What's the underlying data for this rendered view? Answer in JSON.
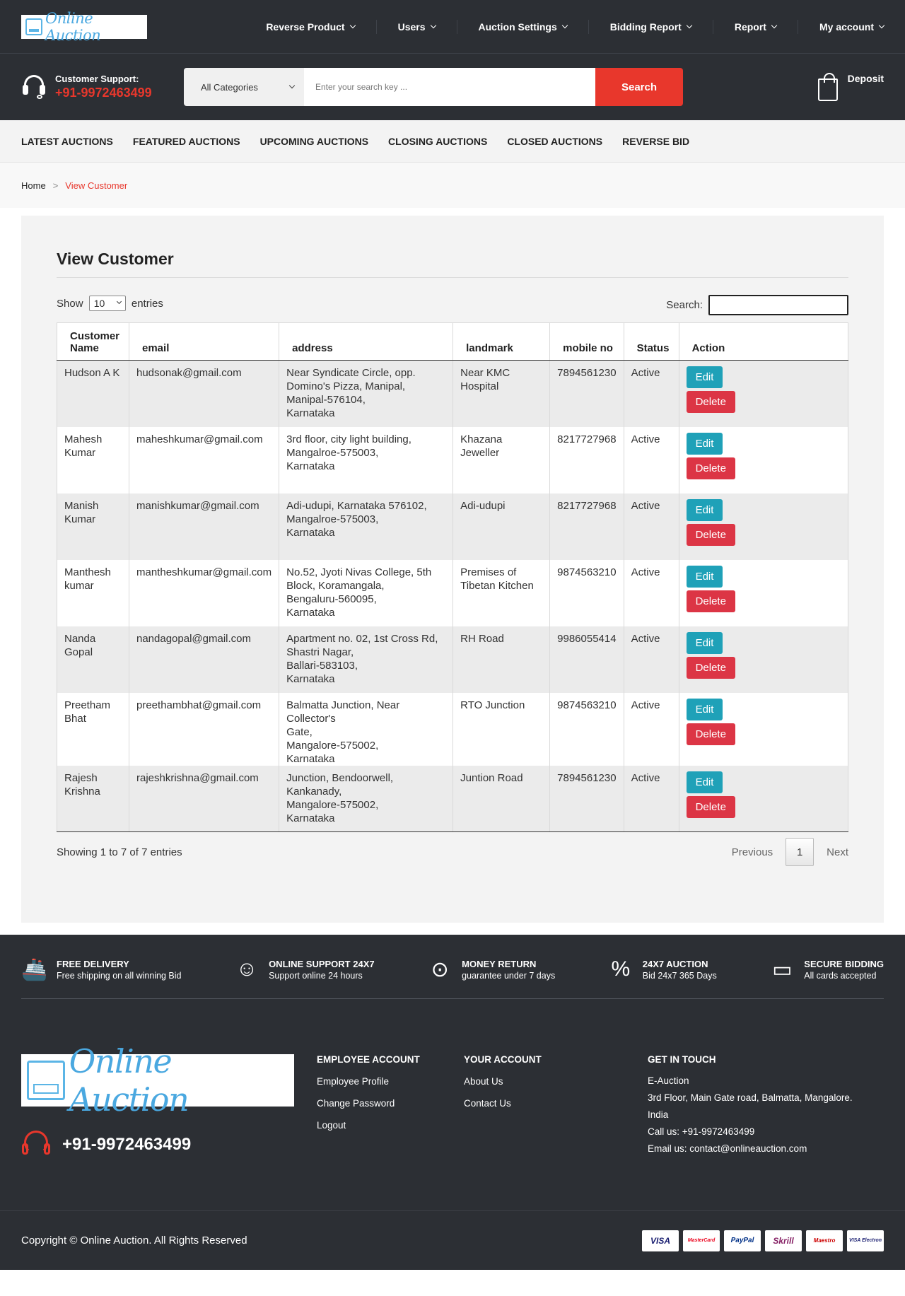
{
  "brand": {
    "logo_text": "Online Auction"
  },
  "topnav": [
    {
      "label": "Reverse Product"
    },
    {
      "label": "Users"
    },
    {
      "label": "Auction Settings"
    },
    {
      "label": "Bidding Report"
    },
    {
      "label": "Report"
    },
    {
      "label": "My account"
    }
  ],
  "support": {
    "label": "Customer Support:",
    "phone": "+91-9972463499"
  },
  "search": {
    "category": "All Categories",
    "placeholder": "Enter your search key ...",
    "button": "Search"
  },
  "deposit": {
    "label": "Deposit"
  },
  "catnav": [
    "LATEST AUCTIONS",
    "FEATURED AUCTIONS",
    "UPCOMING AUCTIONS",
    "CLOSING AUCTIONS",
    "CLOSED AUCTIONS",
    "REVERSE BID"
  ],
  "breadcrumb": {
    "home": "Home",
    "sep": ">",
    "current": "View Customer"
  },
  "page": {
    "title": "View Customer"
  },
  "table_controls": {
    "show": "Show",
    "entries_value": "10",
    "entries": "entries",
    "search_label": "Search:"
  },
  "table": {
    "headers": [
      "Customer Name",
      "email",
      "address",
      "landmark",
      "mobile no",
      "Status",
      "Action"
    ],
    "rows": [
      {
        "name": "Hudson A K",
        "email": "hudsonak@gmail.com",
        "address": "Near Syndicate Circle, opp.\nDomino's Pizza, Manipal,\nManipal-576104,\nKarnataka",
        "landmark": "Near KMC Hospital",
        "mobile": "7894561230",
        "status": "Active"
      },
      {
        "name": "Mahesh\nKumar",
        "email": "maheshkumar@gmail.com",
        "address": "3rd floor, city light building,\nMangalroe-575003,\nKarnataka",
        "landmark": "Khazana Jeweller",
        "mobile": "8217727968",
        "status": "Active"
      },
      {
        "name": "Manish\nKumar",
        "email": "manishkumar@gmail.com",
        "address": "Adi-udupi, Karnataka 576102,\nMangalroe-575003,\nKarnataka",
        "landmark": "Adi-udupi",
        "mobile": "8217727968",
        "status": "Active"
      },
      {
        "name": "Manthesh\nkumar",
        "email": "mantheshkumar@gmail.com",
        "address": "No.52, Jyoti Nivas College, 5th\nBlock, Koramangala,\nBengaluru-560095,\nKarnataka",
        "landmark": "Premises of\nTibetan Kitchen",
        "mobile": "9874563210",
        "status": "Active"
      },
      {
        "name": "Nanda\nGopal",
        "email": "nandagopal@gmail.com",
        "address": "Apartment no. 02, 1st Cross Rd,\nShastri Nagar,\nBallari-583103,\nKarnataka",
        "landmark": "RH Road",
        "mobile": "9986055414",
        "status": "Active"
      },
      {
        "name": "Preetham\nBhat",
        "email": "preethambhat@gmail.com",
        "address": "Balmatta Junction, Near Collector's\nGate,\nMangalore-575002,\nKarnataka",
        "landmark": "RTO Junction",
        "mobile": "9874563210",
        "status": "Active"
      },
      {
        "name": "Rajesh\nKrishna",
        "email": "rajeshkrishna@gmail.com",
        "address": "Junction, Bendoorwell, Kankanady,\nMangalore-575002,\nKarnataka",
        "landmark": "Juntion Road",
        "mobile": "7894561230",
        "status": "Active"
      }
    ],
    "edit_label": "Edit",
    "delete_label": "Delete"
  },
  "table_footer": {
    "info": "Showing 1 to 7 of 7 entries",
    "previous": "Previous",
    "page": "1",
    "next": "Next"
  },
  "features": [
    {
      "icon": "ship-icon",
      "title": "FREE DELIVERY",
      "sub": "Free shipping on all winning Bid"
    },
    {
      "icon": "support-agent-icon",
      "title": "ONLINE SUPPORT 24X7",
      "sub": "Support online 24 hours"
    },
    {
      "icon": "piggy-bank-icon",
      "title": "MONEY RETURN",
      "sub": "guarantee under 7 days"
    },
    {
      "icon": "percent-badge-icon",
      "title": "24X7 AUCTION",
      "sub": "Bid 24x7 365 Days"
    },
    {
      "icon": "credit-card-icon",
      "title": "SECURE BIDDING",
      "sub": "All cards accepted"
    }
  ],
  "footer": {
    "phone": "+91-9972463499",
    "employee": {
      "heading": "EMPLOYEE ACCOUNT",
      "links": [
        "Employee Profile",
        "Change Password",
        "Logout"
      ]
    },
    "account": {
      "heading": "YOUR ACCOUNT",
      "links": [
        "About Us",
        "Contact Us"
      ]
    },
    "contact": {
      "heading": "GET IN TOUCH",
      "lines": [
        "E-Auction",
        "3rd Floor, Main Gate road, Balmatta, Mangalore.",
        "India",
        "Call us: +91-9972463499",
        "Email us: contact@onlineauction.com"
      ]
    },
    "copyright": "Copyright © Online Auction. All Rights Reserved",
    "payments": [
      "VISA",
      "MasterCard",
      "PayPal",
      "Skrill",
      "Maestro",
      "VISA Electron"
    ]
  },
  "colors": {
    "accent": "#e8372c",
    "dark": "#2c2f34",
    "edit": "#1fa1b8",
    "delete": "#dc3545"
  }
}
